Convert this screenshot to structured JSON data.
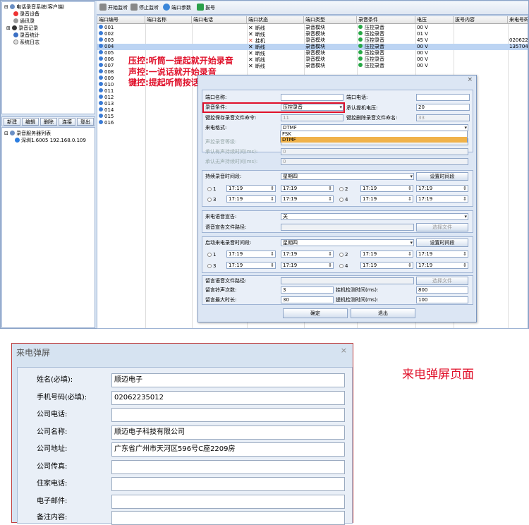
{
  "tree": {
    "root": "电话录音系统(客户端)",
    "items": [
      "录音设备",
      "通讯录",
      "录音记录",
      "录音统计",
      "系统日志"
    ]
  },
  "tabs": [
    "新建",
    "编辑",
    "删除",
    "连接",
    "登出"
  ],
  "server_tree": {
    "root": "录音服务器列表",
    "server": "深圳1.6005 192.168.0.109"
  },
  "toolbar": {
    "start": "开始监听",
    "stop": "停止监听",
    "params": "端口参数",
    "dial": "拔号"
  },
  "grid": {
    "columns": [
      "端口编号",
      "端口名称",
      "端口电话",
      "端口状态",
      "端口类型",
      "录音条件",
      "电压",
      "拔号内容",
      "来电号码"
    ],
    "rows": [
      {
        "id": "001",
        "status": "断线",
        "type": "录音模块",
        "cond": "压控录音",
        "volt": "00 V",
        "num": ""
      },
      {
        "id": "002",
        "status": "断线",
        "type": "录音模块",
        "cond": "压控录音",
        "volt": "01 V",
        "num": ""
      },
      {
        "id": "003",
        "status": "挂机",
        "type": "录音模块",
        "cond": "压控录音",
        "volt": "45 V",
        "num": "02062235"
      },
      {
        "id": "004",
        "status": "断线",
        "type": "录音模块",
        "cond": "压控录音",
        "volt": "00 V",
        "num": "13570434"
      },
      {
        "id": "005",
        "status": "断线",
        "type": "录音模块",
        "cond": "压控录音",
        "volt": "00 V",
        "num": ""
      },
      {
        "id": "006",
        "status": "断线",
        "type": "录音模块",
        "cond": "压控录音",
        "volt": "00 V",
        "num": ""
      },
      {
        "id": "007",
        "status": "断线",
        "type": "录音模块",
        "cond": "压控录音",
        "volt": "00 V",
        "num": ""
      },
      {
        "id": "008",
        "status": "",
        "type": "",
        "cond": "",
        "volt": "",
        "num": ""
      },
      {
        "id": "009",
        "status": "",
        "type": "",
        "cond": "",
        "volt": "",
        "num": ""
      },
      {
        "id": "010",
        "status": "",
        "type": "",
        "cond": "",
        "volt": "",
        "num": ""
      },
      {
        "id": "011",
        "status": "",
        "type": "",
        "cond": "",
        "volt": "",
        "num": ""
      },
      {
        "id": "012",
        "status": "",
        "type": "",
        "cond": "",
        "volt": "",
        "num": ""
      },
      {
        "id": "013",
        "status": "",
        "type": "",
        "cond": "",
        "volt": "",
        "num": ""
      },
      {
        "id": "014",
        "status": "",
        "type": "",
        "cond": "",
        "volt": "",
        "num": ""
      },
      {
        "id": "015",
        "status": "",
        "type": "",
        "cond": "",
        "volt": "",
        "num": ""
      },
      {
        "id": "016",
        "status": "",
        "type": "",
        "cond": "",
        "volt": "",
        "num": ""
      }
    ]
  },
  "annotations": [
    "压控:听筒一提起就开始录音",
    "声控:一说话就开始录音",
    "键控:提起听筒按话机数字键就开始录音"
  ],
  "dialog": {
    "close": "×",
    "port_name_label": "端口名称:",
    "port_phone_label": "端口电话:",
    "record_cond_label": "录音条件:",
    "record_cond_value": "压控录音",
    "hook_voltage_label": "承认提机电压:",
    "hook_voltage_value": "20",
    "save_cmd_label": "键控保存录音文件命令:",
    "save_cmd_value": "11",
    "delete_cmd_label": "键控删除录音文件命名:",
    "delete_cmd_value": "33",
    "caller_format_label": "来电格式:",
    "caller_format_value": "DTMF",
    "caller_options": [
      "FSK",
      "DTMF"
    ],
    "voice_level_label": "声控录音等级:",
    "voice_level_value": "",
    "voice_keep_label": "承认有声持续时间(ms):",
    "voice_keep_value": "0",
    "silence_keep_label": "承认无声持续时间(ms):",
    "silence_keep_value": "0",
    "continuous_label": "持续录音时间段:",
    "weekday": "星期四",
    "set_period_btn": "设置时间段",
    "slots": [
      "1",
      "2",
      "3",
      "4"
    ],
    "time": "17:19",
    "incoming_voice_label": "来电语音宣告:",
    "incoming_voice_value": "关",
    "voice_file_label": "语音宣告文件路径:",
    "choose_file_btn": "选择文件",
    "outgoing_label": "启动来电录音时间段:",
    "message_file_label": "留言语音文件路径:",
    "ring_count_label": "留言铃声次数:",
    "ring_count_value": "3",
    "hangup_detect_label": "挂机检测时间(ms):",
    "hangup_detect_value": "800",
    "max_length_label": "留言最大时长:",
    "max_length_value": "30",
    "pickup_detect_label": "提机检测时间(ms):",
    "pickup_detect_value": "100",
    "ok_btn": "确定",
    "cancel_btn": "退出"
  },
  "popup": {
    "title": "来电弹屏",
    "close": "×",
    "fields": [
      {
        "label": "姓名(必填):",
        "value": "顺迈电子"
      },
      {
        "label": "手机号码(必填):",
        "value": "02062235012"
      },
      {
        "label": "公司电话:",
        "value": ""
      },
      {
        "label": "公司名称:",
        "value": "顺迈电子科技有限公司"
      },
      {
        "label": "公司地址:",
        "value": "广东省广州市天河区596号C座2209房"
      },
      {
        "label": "公司传真:",
        "value": ""
      },
      {
        "label": "住家电话:",
        "value": ""
      },
      {
        "label": "电子邮件:",
        "value": ""
      },
      {
        "label": "备注内容:",
        "value": ""
      }
    ]
  },
  "caption": "来电弹屏页面",
  "colors": {
    "accent_red": "#e0102a",
    "window_bg": "#d7e3f2",
    "select_row": "#bcd4f3"
  }
}
